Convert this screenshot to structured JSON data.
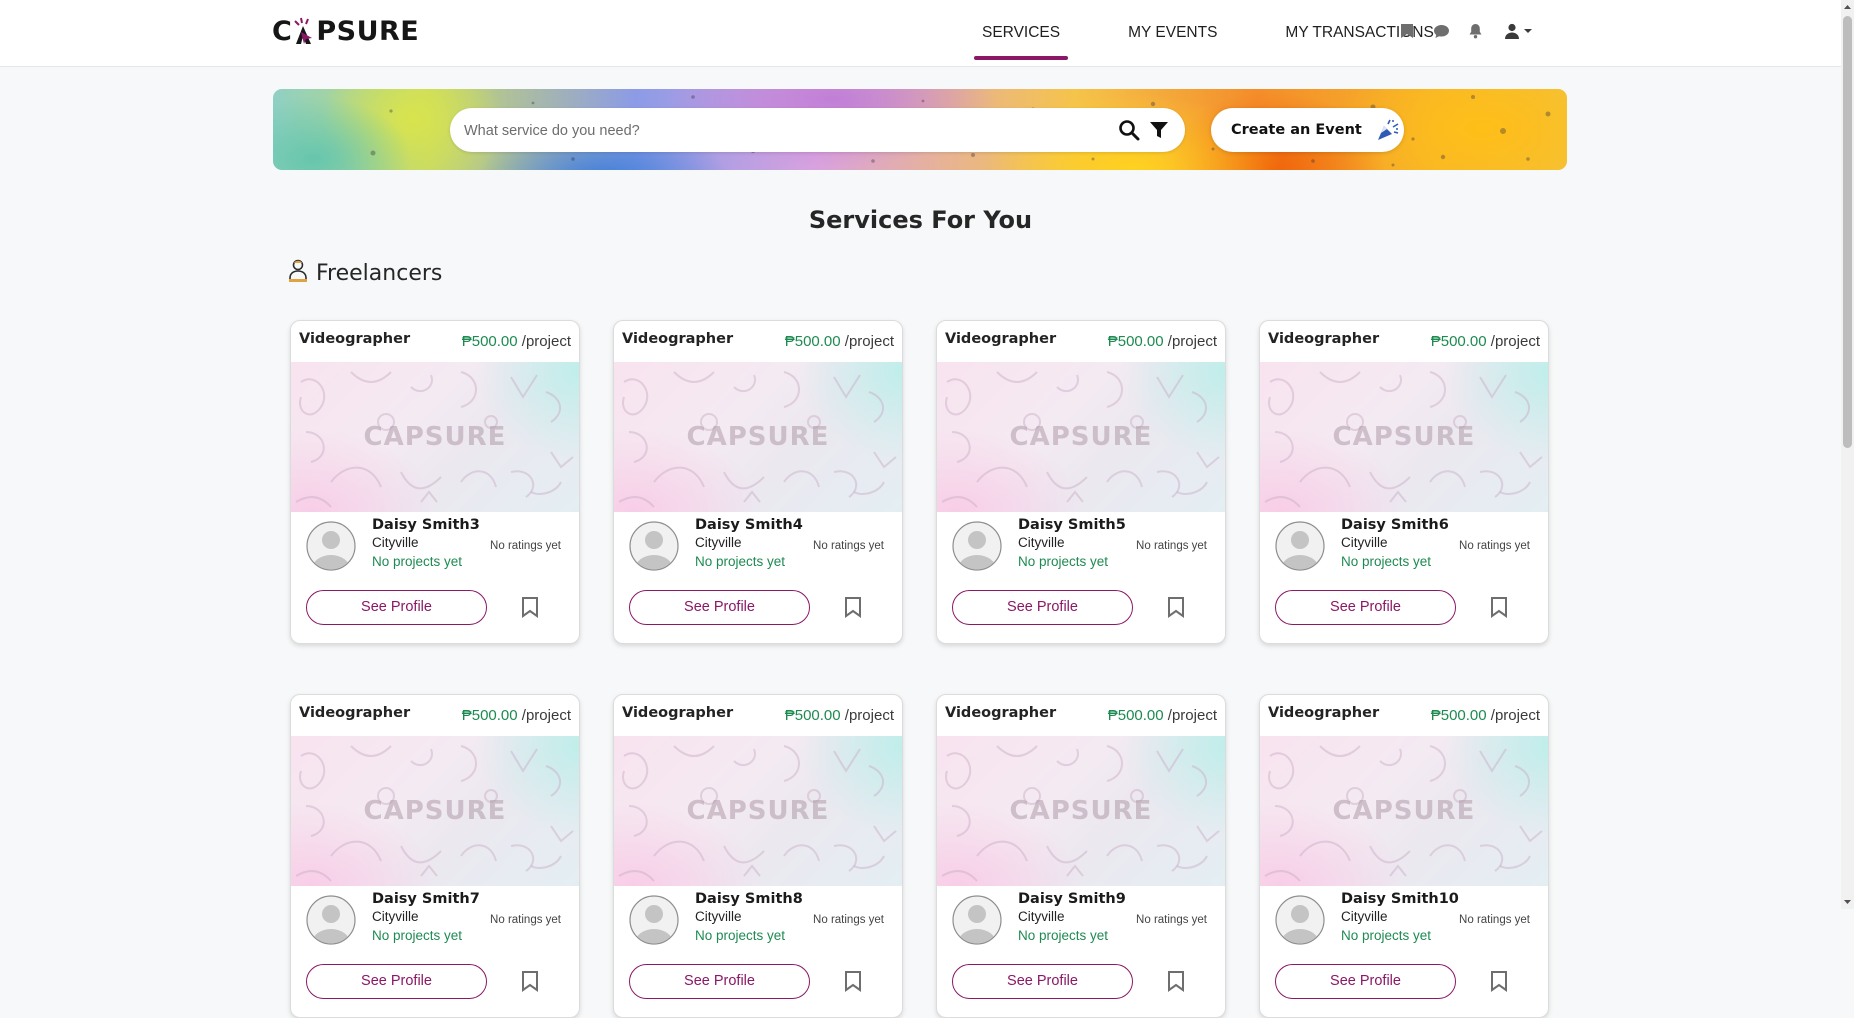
{
  "brand": {
    "name": "CAPSURE",
    "accent": "#8a1866",
    "price_green": "#1e8a52"
  },
  "nav": {
    "links": [
      {
        "label": "SERVICES",
        "active": true
      },
      {
        "label": "MY EVENTS",
        "active": false
      },
      {
        "label": "MY TRANSACTIONS",
        "active": false
      }
    ],
    "icons": [
      "bookmark-icon",
      "chat-icon",
      "bell-icon",
      "user-icon",
      "caret-down-icon"
    ]
  },
  "search": {
    "placeholder": "What service do you need?",
    "value": "",
    "icons": [
      "search-icon",
      "filter-icon"
    ]
  },
  "create_event": {
    "label": "Create an Event",
    "icon": "party-popper-icon"
  },
  "page_title": "Services For You",
  "section": {
    "label": "Freelancers",
    "icon": "freelancer-icon"
  },
  "cards": [
    {
      "title": "Videographer",
      "price": "₱500.00",
      "unit": "/project",
      "thumb_text": "CAPSURE",
      "name": "Daisy Smith3",
      "city": "Cityville",
      "projects": "No projects yet",
      "ratings": "No ratings yet",
      "button": "See Profile"
    },
    {
      "title": "Videographer",
      "price": "₱500.00",
      "unit": "/project",
      "thumb_text": "CAPSURE",
      "name": "Daisy Smith4",
      "city": "Cityville",
      "projects": "No projects yet",
      "ratings": "No ratings yet",
      "button": "See Profile"
    },
    {
      "title": "Videographer",
      "price": "₱500.00",
      "unit": "/project",
      "thumb_text": "CAPSURE",
      "name": "Daisy Smith5",
      "city": "Cityville",
      "projects": "No projects yet",
      "ratings": "No ratings yet",
      "button": "See Profile"
    },
    {
      "title": "Videographer",
      "price": "₱500.00",
      "unit": "/project",
      "thumb_text": "CAPSURE",
      "name": "Daisy Smith6",
      "city": "Cityville",
      "projects": "No projects yet",
      "ratings": "No ratings yet",
      "button": "See Profile"
    },
    {
      "title": "Videographer",
      "price": "₱500.00",
      "unit": "/project",
      "thumb_text": "CAPSURE",
      "name": "Daisy Smith7",
      "city": "Cityville",
      "projects": "No projects yet",
      "ratings": "No ratings yet",
      "button": "See Profile"
    },
    {
      "title": "Videographer",
      "price": "₱500.00",
      "unit": "/project",
      "thumb_text": "CAPSURE",
      "name": "Daisy Smith8",
      "city": "Cityville",
      "projects": "No projects yet",
      "ratings": "No ratings yet",
      "button": "See Profile"
    },
    {
      "title": "Videographer",
      "price": "₱500.00",
      "unit": "/project",
      "thumb_text": "CAPSURE",
      "name": "Daisy Smith9",
      "city": "Cityville",
      "projects": "No projects yet",
      "ratings": "No ratings yet",
      "button": "See Profile"
    },
    {
      "title": "Videographer",
      "price": "₱500.00",
      "unit": "/project",
      "thumb_text": "CAPSURE",
      "name": "Daisy Smith10",
      "city": "Cityville",
      "projects": "No projects yet",
      "ratings": "No ratings yet",
      "button": "See Profile"
    }
  ]
}
